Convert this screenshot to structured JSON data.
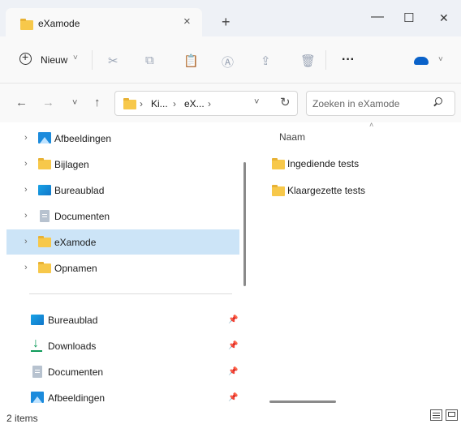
{
  "window": {
    "tab_title": "eXamode",
    "tab_close": "×",
    "new_tab": "+",
    "minimize": "—",
    "maximize": "☐",
    "close": "✕"
  },
  "toolbar": {
    "new_label": "Nieuw",
    "new_caret": "˅",
    "more": "···",
    "onedrive_caret": "˅"
  },
  "address": {
    "crumbs": [
      "Ki...",
      "eX...",
      ""
    ],
    "sep": "›",
    "dropdown": "˅",
    "refresh": "↻",
    "search_placeholder": "Zoeken in eXamode"
  },
  "nav": {
    "tree": [
      {
        "label": "Afbeeldingen",
        "icon": "pictures-icon"
      },
      {
        "label": "Bijlagen",
        "icon": "folder-icon"
      },
      {
        "label": "Bureaublad",
        "icon": "desktop-icon"
      },
      {
        "label": "Documenten",
        "icon": "documents-icon"
      },
      {
        "label": "eXamode",
        "icon": "folder-icon",
        "selected": true
      },
      {
        "label": "Opnamen",
        "icon": "folder-icon"
      }
    ],
    "quick": [
      {
        "label": "Bureaublad",
        "icon": "desktop-icon"
      },
      {
        "label": "Downloads",
        "icon": "download-icon"
      },
      {
        "label": "Documenten",
        "icon": "documents-icon"
      },
      {
        "label": "Afbeeldingen",
        "icon": "pictures-icon"
      }
    ],
    "chevron": "›",
    "pin": "📌"
  },
  "content": {
    "column_name": "Naam",
    "sort_indicator": "˄",
    "items": [
      "Ingediende tests",
      "Klaargezette tests"
    ]
  },
  "status": {
    "count": "2 items"
  },
  "colors": {
    "accent_selected": "#cce4f7",
    "folder": "#f7c84a",
    "titlebar": "#eef1f6"
  }
}
